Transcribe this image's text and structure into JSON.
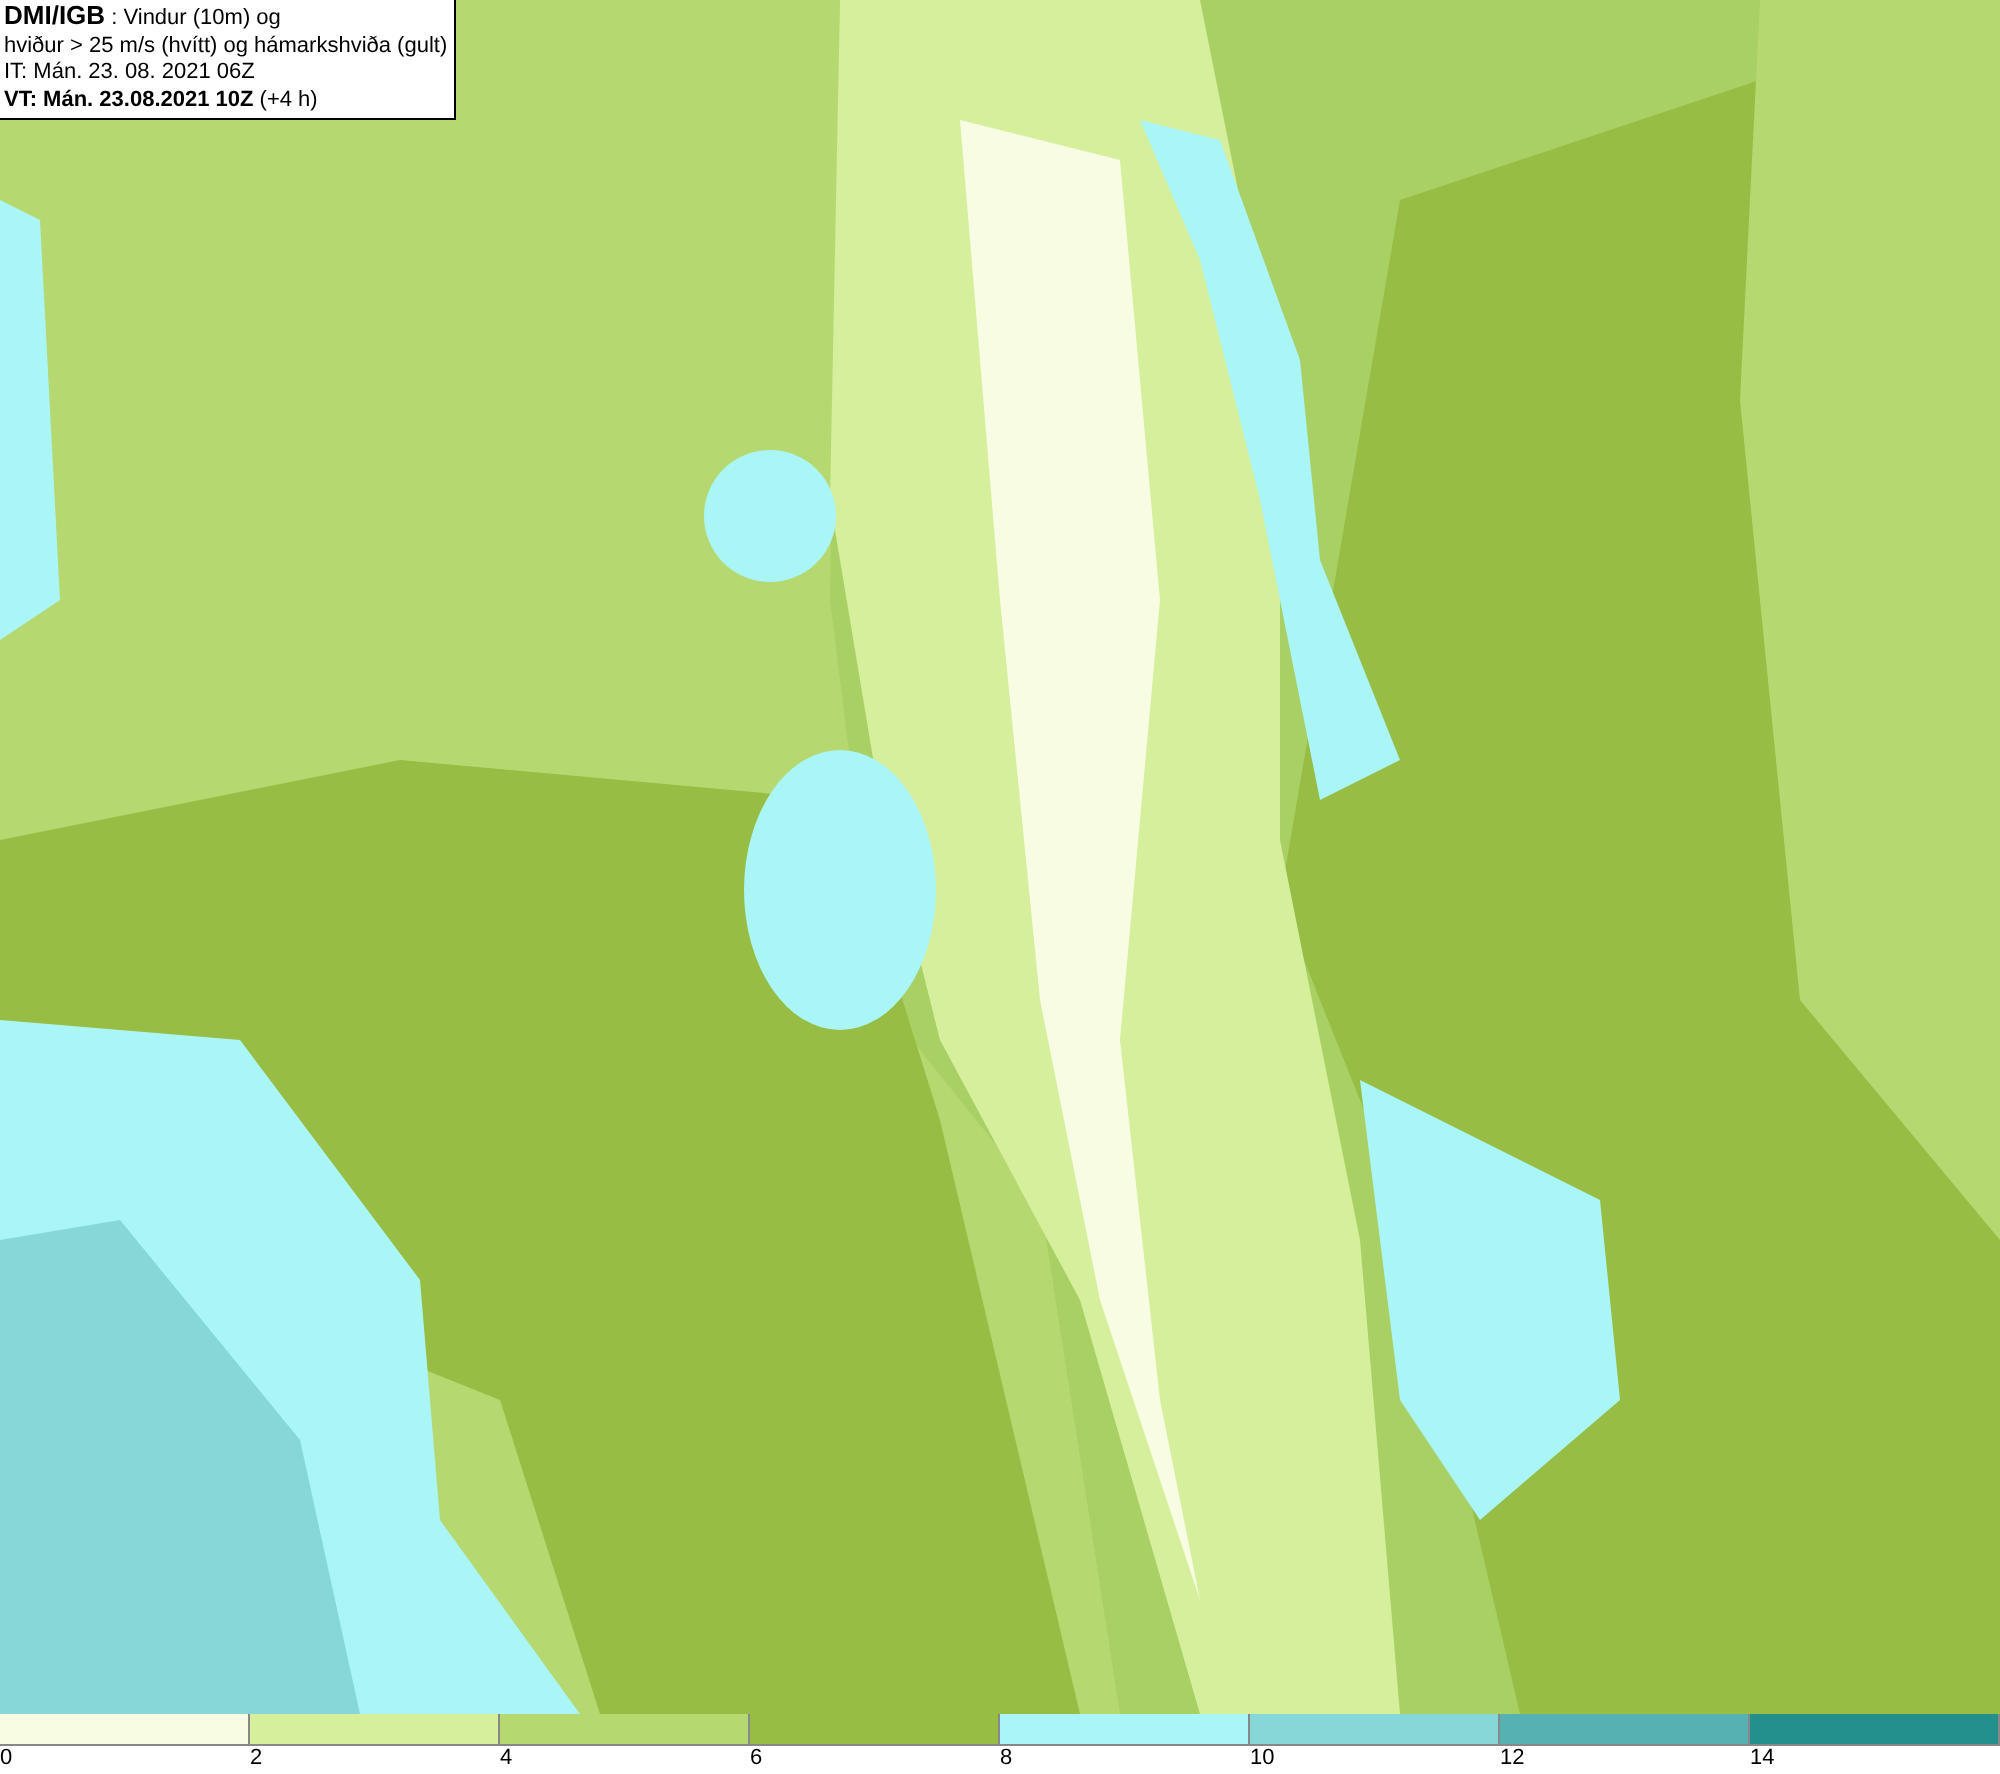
{
  "info_box": {
    "lines": [
      "**DMI/IGB** : Vindur (10m) og",
      "hviður > 25 m/s (hvítt) og hámarkshviða (gult)",
      "IT: Mán. 23. 08. 2021 06Z",
      "**VT: Mán. 23.08.2021 10Z** (+4 h)"
    ]
  },
  "legend": [
    {
      "label": "0",
      "color": "#f8fce2"
    },
    {
      "label": "2",
      "color": "#d6ef9c"
    },
    {
      "label": "4",
      "color": "#b6d870"
    },
    {
      "label": "6",
      "color": "#98bd45"
    },
    {
      "label": "8",
      "color": "#aaf6f6"
    },
    {
      "label": "10",
      "color": "#86d8d8"
    },
    {
      "label": "12",
      "color": "#56b2b2"
    },
    {
      "label": "14",
      "color": "#23908e"
    }
  ]
}
